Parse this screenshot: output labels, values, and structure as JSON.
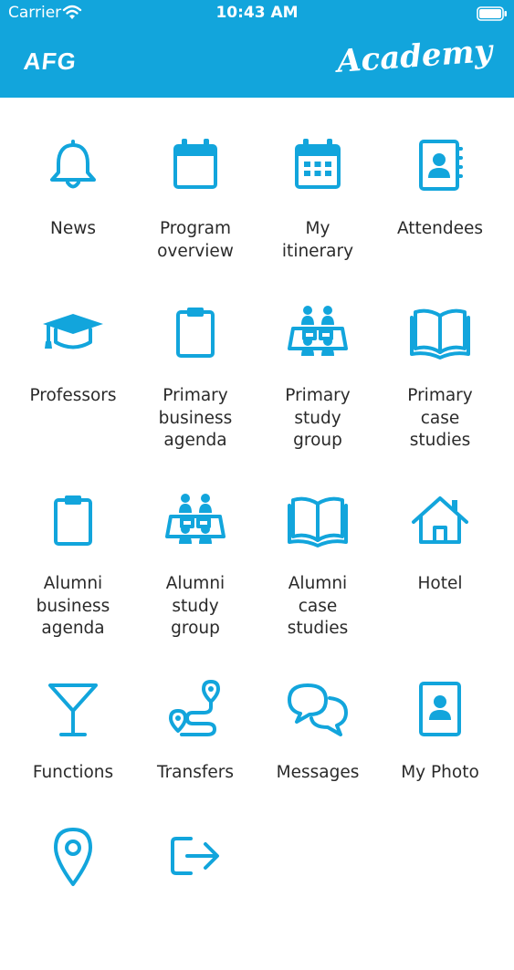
{
  "status_bar": {
    "carrier": "Carrier",
    "time": "10:43 AM"
  },
  "header": {
    "brand_left": "AFG",
    "brand_right": "Academy",
    "background_color": "#12a5dc"
  },
  "accent_color": "#12a5dc",
  "menu": [
    {
      "label": "News",
      "icon": "bell-icon"
    },
    {
      "label": "Program\noverview",
      "icon": "calendar-icon"
    },
    {
      "label": "My\nitinerary",
      "icon": "calendar-grid-icon"
    },
    {
      "label": "Attendees",
      "icon": "address-book-icon"
    },
    {
      "label": "Professors",
      "icon": "graduation-cap-icon"
    },
    {
      "label": "Primary\nbusiness\nagenda",
      "icon": "clipboard-icon"
    },
    {
      "label": "Primary\nstudy\ngroup",
      "icon": "study-group-icon"
    },
    {
      "label": "Primary\ncase\nstudies",
      "icon": "open-book-icon"
    },
    {
      "label": "Alumni\nbusiness\nagenda",
      "icon": "clipboard-icon"
    },
    {
      "label": "Alumni\nstudy\ngroup",
      "icon": "study-group-icon"
    },
    {
      "label": "Alumni\ncase\nstudies",
      "icon": "open-book-icon"
    },
    {
      "label": "Hotel",
      "icon": "house-icon"
    },
    {
      "label": "Functions",
      "icon": "cocktail-glass-icon"
    },
    {
      "label": "Transfers",
      "icon": "route-icon"
    },
    {
      "label": "Messages",
      "icon": "chat-bubbles-icon"
    },
    {
      "label": "My Photo",
      "icon": "photo-id-icon"
    },
    {
      "label": "",
      "icon": "map-pin-icon"
    },
    {
      "label": "",
      "icon": "logout-icon"
    }
  ]
}
